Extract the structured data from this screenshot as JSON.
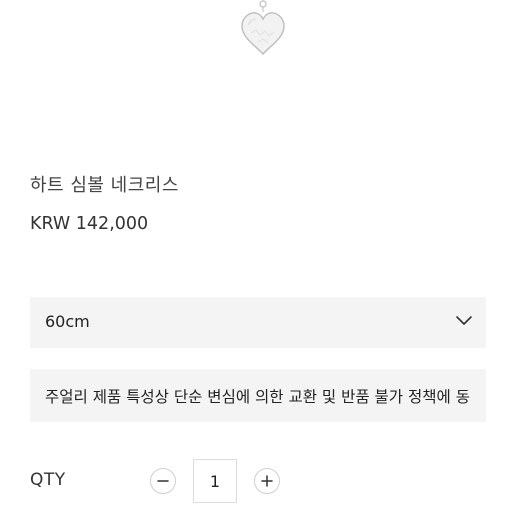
{
  "product": {
    "image_icon": "heart-pendant-image",
    "title": "하트 심볼 네크리스",
    "price": "KRW 142,000"
  },
  "option_select": {
    "selected_value": "60cm",
    "icon": "chevron-down-icon"
  },
  "notice": {
    "text": "주얼리 제품 특성상 단순 변심에 의한 교환 및 반품 불가 정책에 동"
  },
  "quantity": {
    "label": "QTY",
    "value": "1",
    "minus_icon": "minus-icon",
    "plus_icon": "plus-icon"
  }
}
